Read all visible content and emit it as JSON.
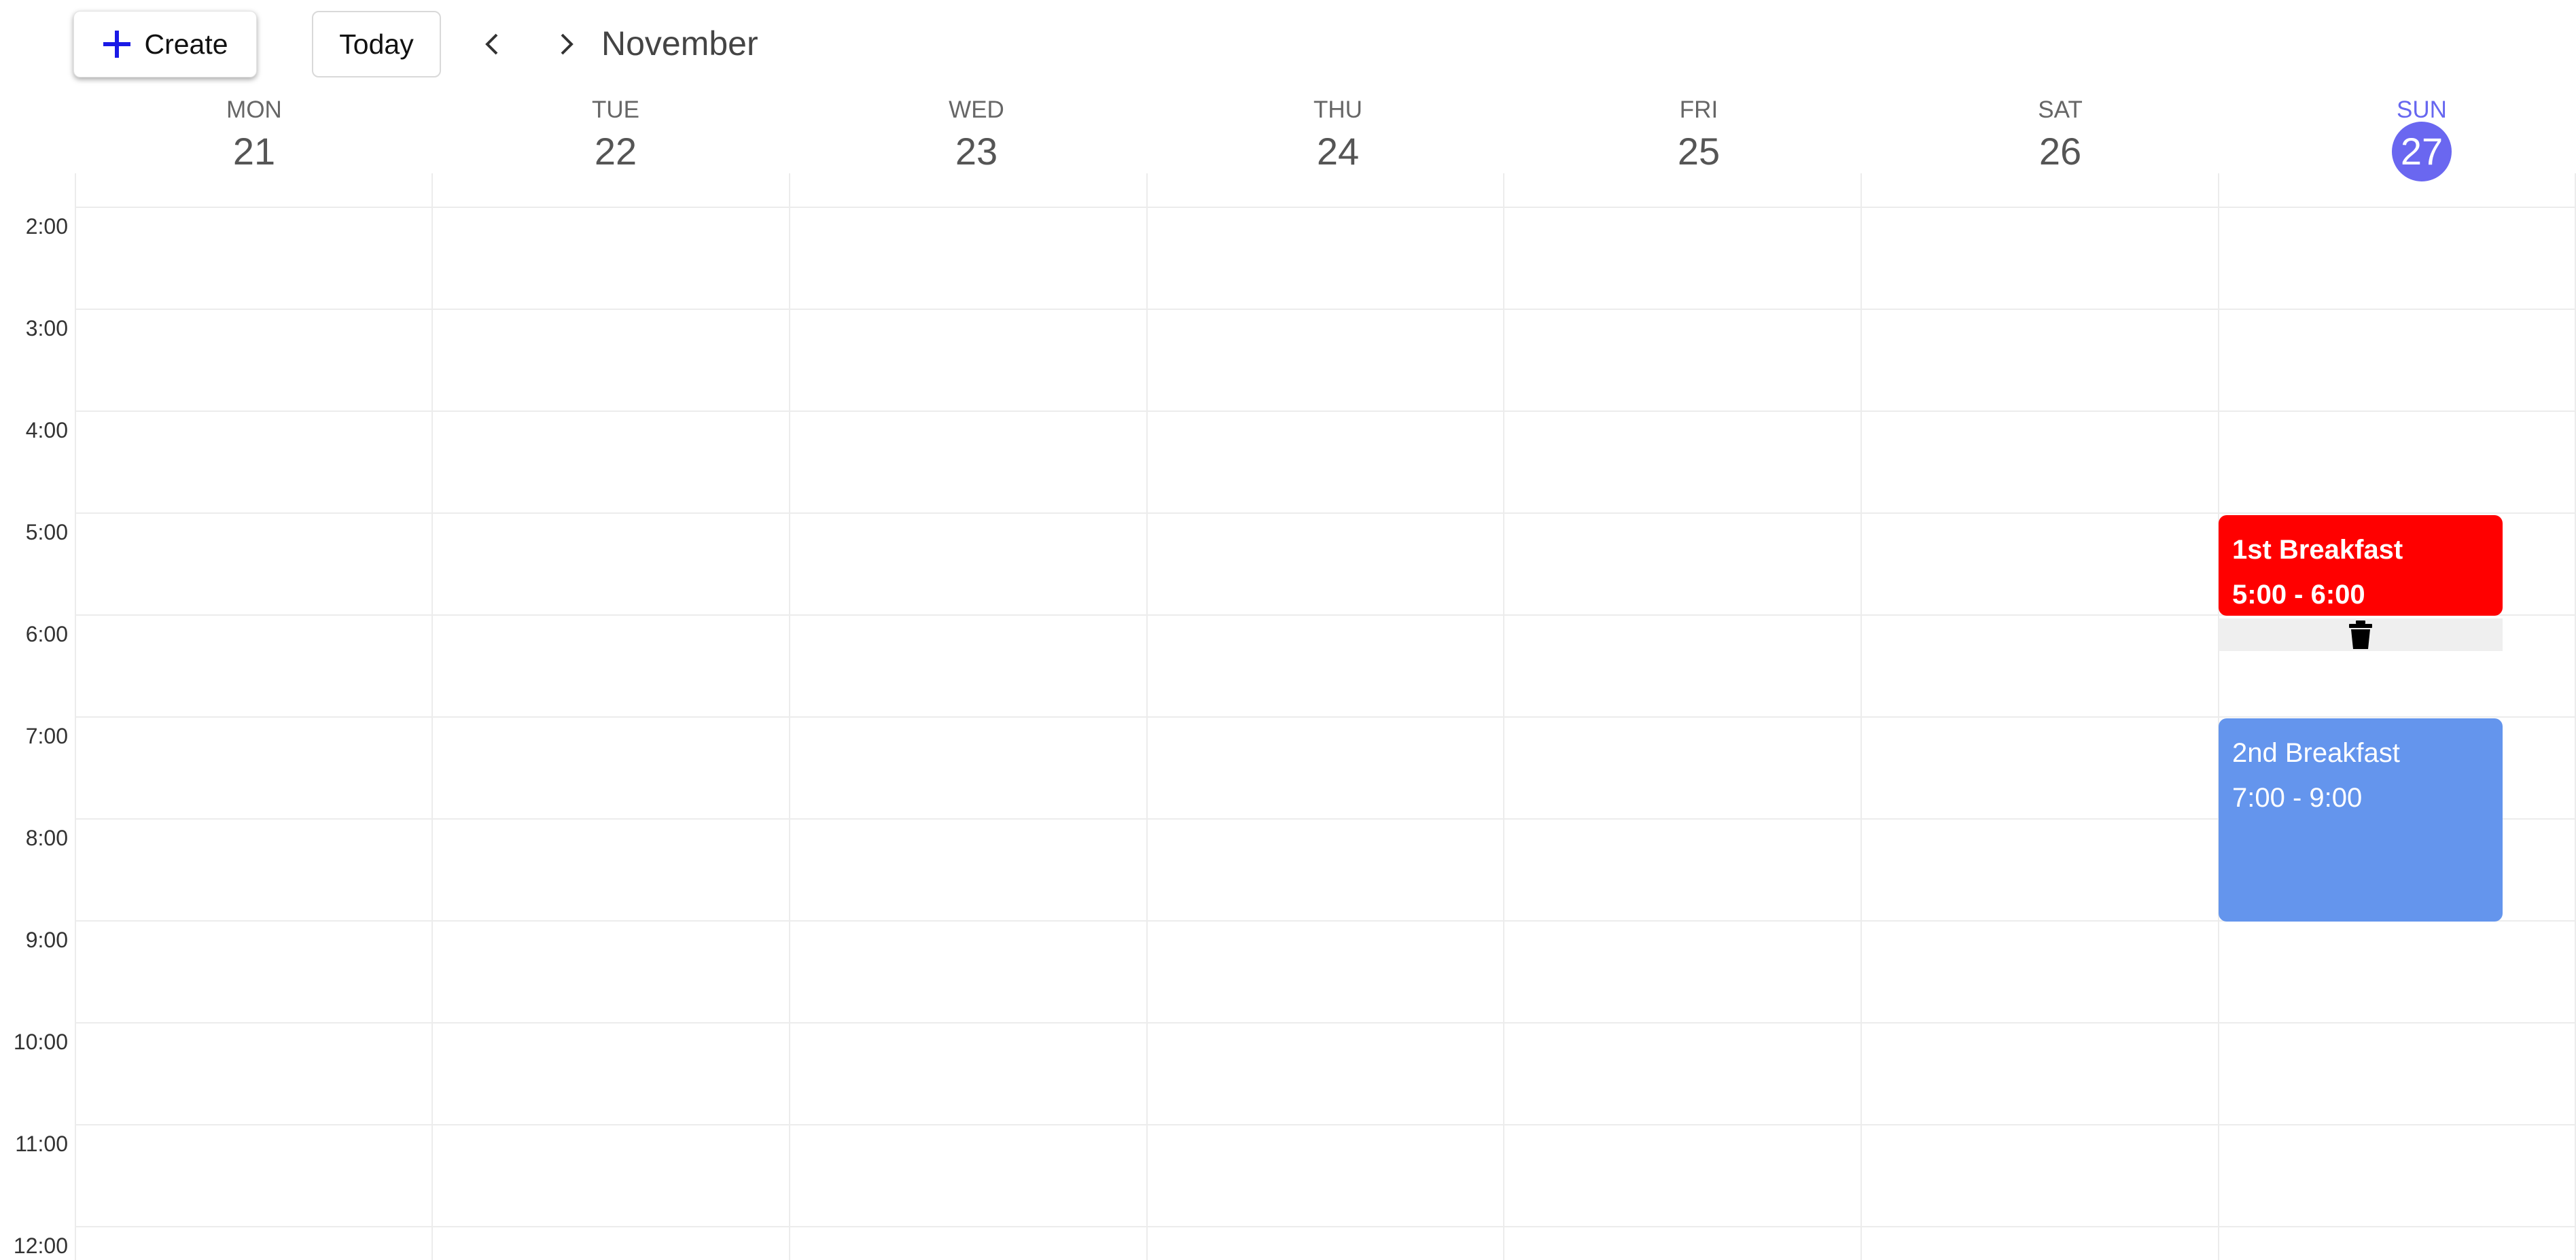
{
  "toolbar": {
    "create_label": "Create",
    "today_label": "Today",
    "month": "November"
  },
  "days": [
    {
      "name": "MON",
      "num": "21"
    },
    {
      "name": "TUE",
      "num": "22"
    },
    {
      "name": "WED",
      "num": "23"
    },
    {
      "name": "THU",
      "num": "24"
    },
    {
      "name": "FRI",
      "num": "25"
    },
    {
      "name": "SAT",
      "num": "26"
    },
    {
      "name": "SUN",
      "num": "27",
      "today": true
    }
  ],
  "hours": [
    "2:00",
    "3:00",
    "4:00",
    "5:00",
    "6:00",
    "7:00",
    "8:00",
    "9:00",
    "10:00",
    "11:00",
    "12:00"
  ],
  "events": [
    {
      "title": "1st Breakfast",
      "time": "5:00 - 6:00",
      "color": "#ff0000"
    },
    {
      "title": "2nd Breakfast",
      "time": "7:00 - 9:00",
      "color": "#6495ed"
    }
  ],
  "icons": {
    "create": "plus-icon",
    "prev": "chevron-left-icon",
    "next": "chevron-right-icon",
    "delete": "trash-icon"
  },
  "colors": {
    "accent": "#6a67f0",
    "create_plus": "#1a1ae6"
  }
}
